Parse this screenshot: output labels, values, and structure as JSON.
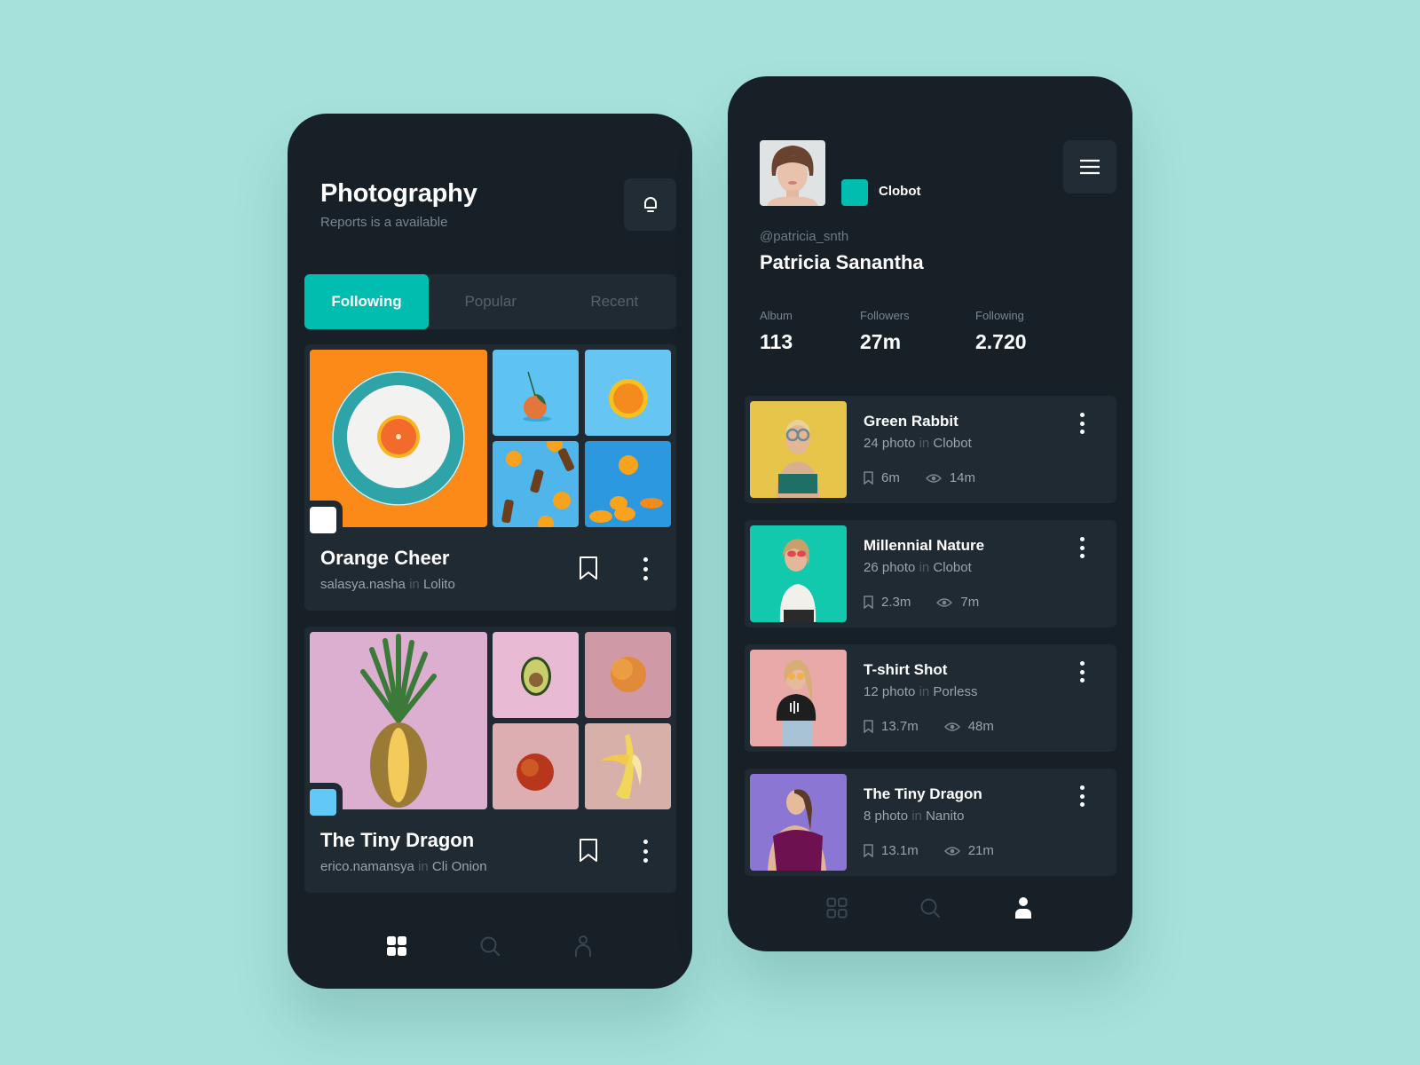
{
  "left_phone": {
    "header": {
      "title": "Photography",
      "subtitle": "Reports is a available",
      "notification_icon": "bell-icon"
    },
    "tabs": [
      {
        "label": "Following",
        "active": true
      },
      {
        "label": "Popular",
        "active": false
      },
      {
        "label": "Recent",
        "active": false
      }
    ],
    "albums": [
      {
        "title": "Orange Cheer",
        "author": "salasya.nasha",
        "in_word": "in",
        "collection": "Lolito",
        "badge_color": "#ffffff",
        "images": [
          "orange-on-plate",
          "tangerine-with-leaf",
          "orange-slice",
          "orange-drinks-with-ice",
          "floating-orange-slices"
        ]
      },
      {
        "title": "The Tiny Dragon",
        "author": "erico.namansya",
        "in_word": "in",
        "collection": "Cli Onion",
        "badge_color": "#62c8f5",
        "images": [
          "pineapple",
          "avocado",
          "peach",
          "nectarine",
          "banana"
        ]
      }
    ],
    "bottom_nav": [
      {
        "icon": "grid-icon",
        "active": true
      },
      {
        "icon": "search-icon",
        "active": false
      },
      {
        "icon": "user-icon",
        "active": false
      }
    ]
  },
  "right_phone": {
    "profile": {
      "avatar": "avatar-photo",
      "brand_name": "Clobot",
      "brand_color": "#00bdb0",
      "handle": "@patricia_snth",
      "name": "Patricia Sanantha",
      "menu_icon": "hamburger-icon"
    },
    "stats": [
      {
        "label": "Album",
        "value": "113"
      },
      {
        "label": "Followers",
        "value": "27m"
      },
      {
        "label": "Following",
        "value": "2.720"
      }
    ],
    "collections": [
      {
        "title": "Green Rabbit",
        "count": "24 photo",
        "in_word": "in",
        "brand": "Clobot",
        "saves": "6m",
        "views": "14m",
        "image": "woman-yellow-wall"
      },
      {
        "title": "Millennial Nature",
        "count": "26 photo",
        "in_word": "in",
        "brand": "Clobot",
        "saves": "2.3m",
        "views": "7m",
        "image": "woman-teal-wall"
      },
      {
        "title": "T-shirt Shot",
        "count": "12 photo",
        "in_word": "in",
        "brand": "Porless",
        "saves": "13.7m",
        "views": "48m",
        "image": "woman-pink-wall"
      },
      {
        "title": "The Tiny Dragon",
        "count": "8 photo",
        "in_word": "in",
        "brand": "Nanito",
        "saves": "13.1m",
        "views": "21m",
        "image": "woman-purple-background"
      }
    ],
    "bottom_nav": [
      {
        "icon": "grid-icon",
        "active": false
      },
      {
        "icon": "search-icon",
        "active": false
      },
      {
        "icon": "user-icon",
        "active": true
      }
    ]
  },
  "colors": {
    "background": "#a6e1db",
    "phone_bg": "#172027",
    "card_bg": "#202a33",
    "accent": "#00bdb0"
  }
}
